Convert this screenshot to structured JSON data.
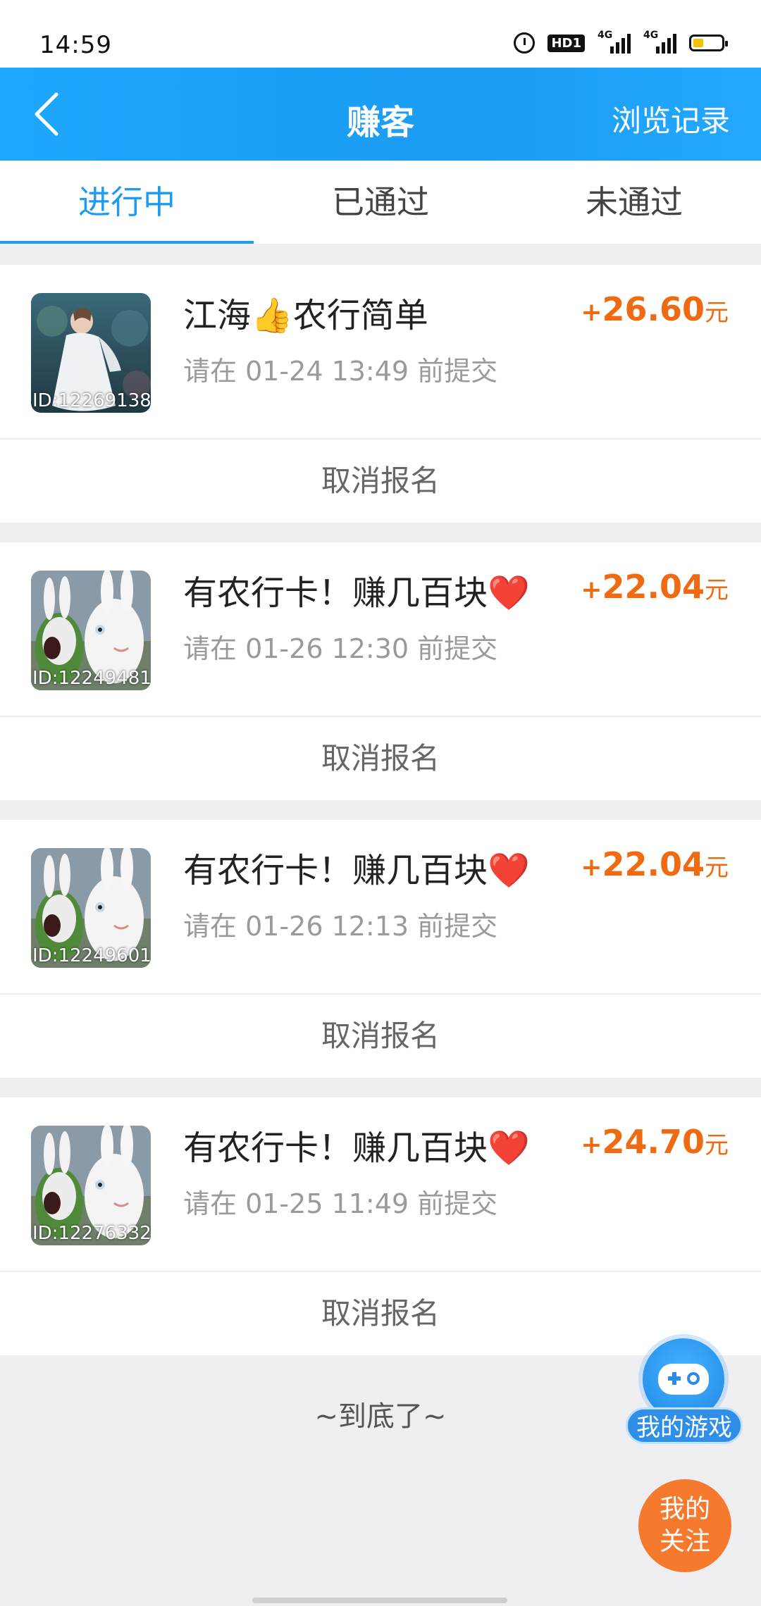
{
  "status_bar": {
    "time": "14:59",
    "hd_label": "HD1",
    "signal_1_label": "4G",
    "signal_2_label": "4G"
  },
  "header": {
    "title": "赚客",
    "history_label": "浏览记录"
  },
  "tabs": [
    {
      "label": "进行中",
      "active": true
    },
    {
      "label": "已通过",
      "active": false
    },
    {
      "label": "未通过",
      "active": false
    }
  ],
  "tasks": [
    {
      "id_label": "ID:12269138",
      "title": "江海👍农行简单",
      "deadline": "请在 01-24 13:49 前提交",
      "reward_sign": "+",
      "reward_amount": "26.60",
      "reward_unit": "元",
      "cancel_label": "取消报名",
      "thumb": "portrait"
    },
    {
      "id_label": "ID:12249481",
      "title": "有农行卡！赚几百块❤️",
      "deadline": "请在 01-26 12:30 前提交",
      "reward_sign": "+",
      "reward_amount": "22.04",
      "reward_unit": "元",
      "cancel_label": "取消报名",
      "thumb": "rabbits"
    },
    {
      "id_label": "ID:12249601",
      "title": "有农行卡！赚几百块❤️",
      "deadline": "请在 01-26 12:13 前提交",
      "reward_sign": "+",
      "reward_amount": "22.04",
      "reward_unit": "元",
      "cancel_label": "取消报名",
      "thumb": "rabbits"
    },
    {
      "id_label": "ID:12276332",
      "title": "有农行卡！赚几百块❤️",
      "deadline": "请在 01-25 11:49 前提交",
      "reward_sign": "+",
      "reward_amount": "24.70",
      "reward_unit": "元",
      "cancel_label": "取消报名",
      "thumb": "rabbits"
    }
  ],
  "end_text": "~到底了~",
  "floating": {
    "games_label": "我的游戏",
    "follow_line1": "我的",
    "follow_line2": "关注"
  },
  "colors": {
    "header_blue": "#1fa7ff",
    "active_tab": "#1d9bf0",
    "reward_orange": "#f06a12",
    "follow_orange": "#f57a2e"
  }
}
